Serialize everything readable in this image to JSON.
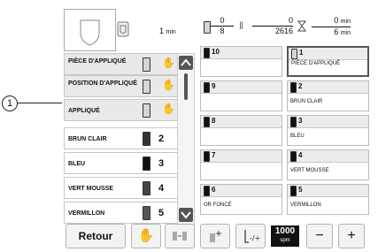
{
  "callout": {
    "label": "1"
  },
  "stats": {
    "time_value": "1",
    "time_unit": "min",
    "colors_current": "0",
    "colors_total": "8",
    "stitches_current": "0",
    "stitches_total": "2616",
    "remaining_value": "0",
    "remaining_unit": "min",
    "total_value": "6",
    "total_unit": "min"
  },
  "left_list": [
    {
      "name": "PIÈCE D'APPLIQUÉ",
      "num": "",
      "hand": true
    },
    {
      "name": "POSITION D'APPLIQUÉ",
      "num": "",
      "hand": true
    },
    {
      "name": "APPLIQUÉ",
      "num": "",
      "hand": true
    },
    {
      "name": "BRUN CLAIR",
      "num": "2",
      "hand": false
    },
    {
      "name": "BLEU",
      "num": "3",
      "hand": false
    },
    {
      "name": "VERT MOUSSE",
      "num": "4",
      "hand": false
    },
    {
      "name": "VERMILLON",
      "num": "5",
      "hand": false
    }
  ],
  "grid": [
    {
      "n": "10",
      "name": ""
    },
    {
      "n": "1",
      "name": "PIÈCE D'APPLIQUÉ"
    },
    {
      "n": "9",
      "name": ""
    },
    {
      "n": "2",
      "name": "BRUN CLAIR"
    },
    {
      "n": "8",
      "name": ""
    },
    {
      "n": "3",
      "name": "BLEU"
    },
    {
      "n": "7",
      "name": ""
    },
    {
      "n": "4",
      "name": "VERT MOUSSE"
    },
    {
      "n": "6",
      "name": "OR FONCÉ"
    },
    {
      "n": "5",
      "name": "VERMILLON"
    }
  ],
  "toolbar": {
    "back_label": "Retour",
    "speed_value": "1000",
    "speed_unit": "spm",
    "minus": "−",
    "plus": "+"
  },
  "icons": {
    "hand": "hand-icon",
    "up": "scroll-up-arrow-icon",
    "down": "scroll-down-arrow-icon",
    "needle": "needle-icon",
    "hourglass": "hourglass-icon"
  }
}
